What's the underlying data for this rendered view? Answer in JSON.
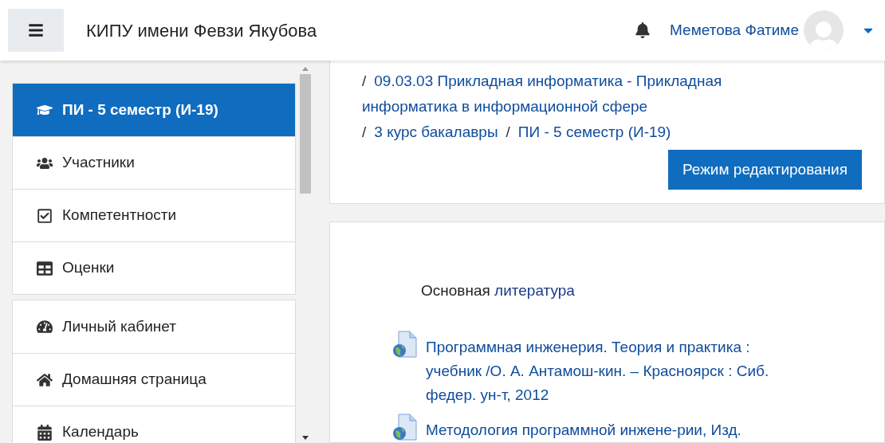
{
  "header": {
    "site_name": "КИПУ имени Февзи Якубова",
    "user_name": "Меметова Фатиме"
  },
  "nav_groups": [
    {
      "items": [
        {
          "kind": "course",
          "label": "ПИ - 5 семестр (И-19)",
          "selected": true
        },
        {
          "kind": "users",
          "label": "Участники",
          "selected": false
        },
        {
          "kind": "check",
          "label": "Компетентности",
          "selected": false
        },
        {
          "kind": "table",
          "label": "Оценки",
          "selected": false
        }
      ]
    },
    {
      "items": [
        {
          "kind": "dashboard",
          "label": "Личный кабинет",
          "selected": false
        },
        {
          "kind": "home",
          "label": "Домашняя страница",
          "selected": false
        },
        {
          "kind": "calendar",
          "label": "Календарь",
          "selected": false
        }
      ]
    }
  ],
  "breadcrumb": [
    {
      "separator": "/",
      "lines": [
        "09.03.03 Прикладная информатика - Прикладная",
        "информатика в информационной сфере"
      ]
    },
    {
      "separator": "/",
      "lines": [
        "3 курс бакалавры"
      ]
    },
    {
      "separator": "/",
      "lines": [
        "ПИ - 5 семестр (И-19)"
      ]
    }
  ],
  "edit_button": "Режим редактирования",
  "section": {
    "label": "Основная",
    "link": "литература",
    "resources": [
      {
        "lines": [
          "Программная инженерия. Теория и практика :",
          "учебник /О. А. Антамош-кин. – Красноярск : Сиб.",
          "федер. ун-т, 2012"
        ]
      },
      {
        "lines": [
          "Методология программной инжене-рии, Изд."
        ]
      }
    ]
  }
}
